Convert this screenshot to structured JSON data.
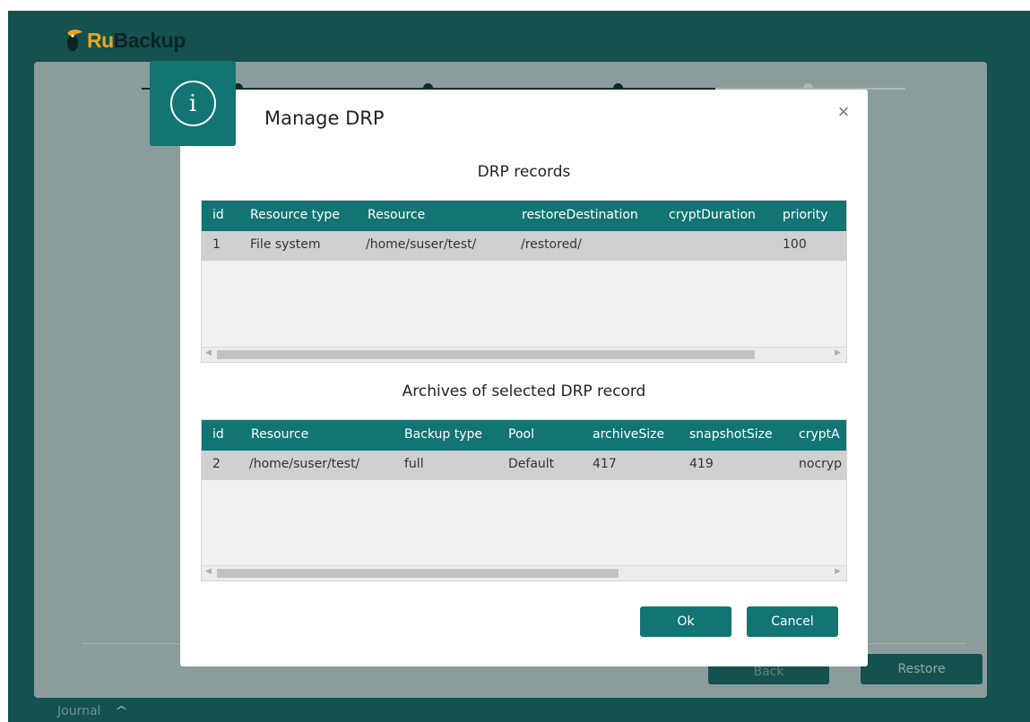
{
  "app": {
    "name_part1": "Ru",
    "name_part2": "Backup"
  },
  "wizard": {
    "back_label": "Back",
    "restore_label": "Restore"
  },
  "journal": {
    "label": "Journal",
    "chevron": "^"
  },
  "dialog": {
    "icon": "info-icon",
    "icon_glyph": "i",
    "title": "Manage DRP",
    "close_glyph": "×",
    "drp_section_title": "DRP records",
    "drp_table": {
      "columns": [
        "id",
        "Resource type",
        "Resource",
        "restoreDestination",
        "cryptDuration",
        "priority"
      ],
      "rows": [
        [
          "1",
          "File system",
          "/home/suser/test/",
          "/restored/",
          "",
          "100"
        ]
      ]
    },
    "archives_section_title": "Archives of selected DRP record",
    "archives_table": {
      "columns": [
        "id",
        "Resource",
        "Backup type",
        "Pool",
        "archiveSize",
        "snapshotSize",
        "cryptA"
      ],
      "rows": [
        [
          "2",
          "/home/suser/test/",
          "full",
          "Default",
          "417",
          "419",
          "nocryp"
        ]
      ]
    },
    "ok_label": "Ok",
    "cancel_label": "Cancel"
  },
  "colors": {
    "brand_teal": "#137474",
    "window_bg": "#14514f",
    "logo_orange": "#f2a31b"
  }
}
